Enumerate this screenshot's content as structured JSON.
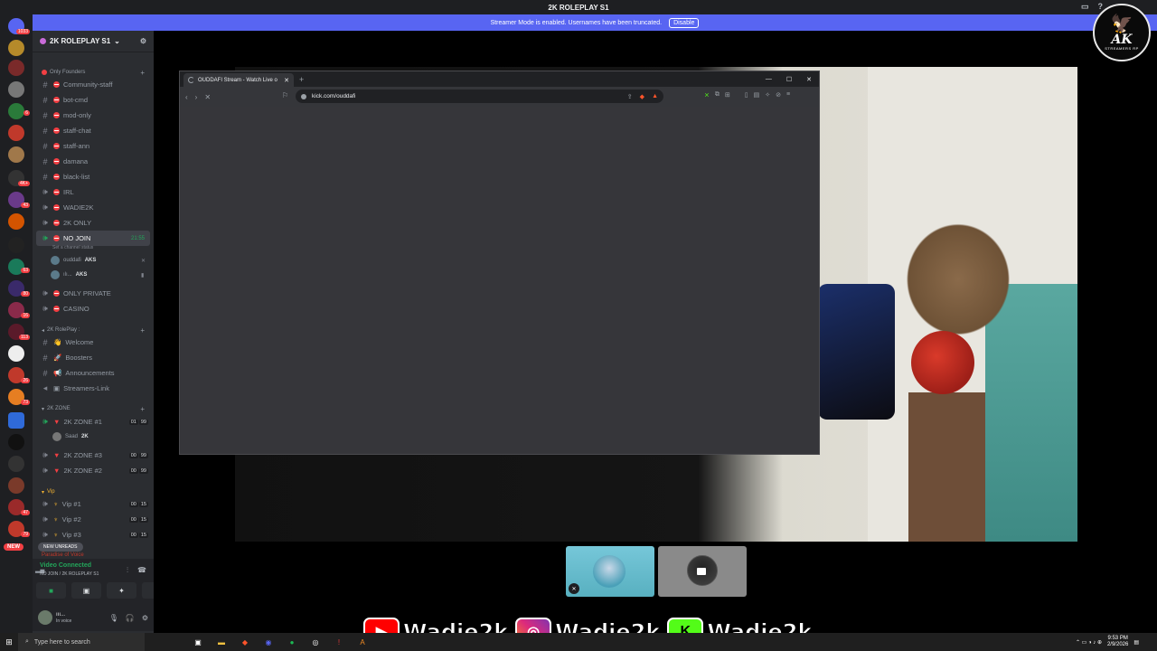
{
  "discord": {
    "window_title": "2K ROLEPLAY S1",
    "notice": {
      "text": "Streamer Mode is enabled. Usernames have been truncated.",
      "button": "Disable"
    },
    "server_name": "2K ROLEPLAY S1",
    "rail_badges": [
      "1033",
      "6",
      "4K+",
      "43",
      "63",
      "80",
      "16",
      "113",
      "26",
      "73",
      "66",
      "47",
      "79"
    ],
    "rail_new": "NEW",
    "categories": {
      "founders": "Only Founders",
      "roleplay": "2K RolePlay :",
      "zone": "2K ZONE",
      "vip": "Vip",
      "paradise": "Paradise of Voice"
    },
    "channels": [
      {
        "name": "Community-staff",
        "type": "text",
        "restricted": true
      },
      {
        "name": "bot-cmd",
        "type": "text",
        "restricted": true
      },
      {
        "name": "mod-only",
        "type": "text",
        "restricted": true
      },
      {
        "name": "staff-chat",
        "type": "text",
        "restricted": true
      },
      {
        "name": "staff-ann",
        "type": "text",
        "restricted": true
      },
      {
        "name": "damana",
        "type": "text",
        "restricted": true
      },
      {
        "name": "black-list",
        "type": "text",
        "restricted": true
      },
      {
        "name": "IRL",
        "type": "voice",
        "restricted": true
      },
      {
        "name": "WADIE2K",
        "type": "voice",
        "restricted": true
      },
      {
        "name": "2K ONLY",
        "type": "voice",
        "restricted": true
      },
      {
        "name": "NO JOIN",
        "type": "voice",
        "restricted": true,
        "time": "21:55",
        "active": true
      },
      {
        "name": "ONLY PRIVATE",
        "type": "voice",
        "restricted": true
      },
      {
        "name": "CASINO",
        "type": "voice",
        "restricted": true
      }
    ],
    "status_hint": "Set a channel status",
    "voice_members": [
      {
        "name": "ouddafi",
        "tag": "AKS"
      },
      {
        "name": "ılı...",
        "tag": "AKS"
      }
    ],
    "roleplay_channels": [
      {
        "name": "Welcome",
        "icon": "wave"
      },
      {
        "name": "Boosters",
        "icon": "rocket"
      },
      {
        "name": "Announcements",
        "icon": "megaphone"
      },
      {
        "name": "Streamers-Link",
        "icon": "video"
      }
    ],
    "zone_channels": [
      {
        "name": "2K ZONE #1",
        "left": "01",
        "right": "99"
      },
      {
        "name": "2K ZONE #3",
        "left": "00",
        "right": "99"
      },
      {
        "name": "2K ZONE #2",
        "left": "00",
        "right": "99"
      }
    ],
    "zone_member": {
      "name": "Saad",
      "tag": "2K"
    },
    "vip_channels": [
      {
        "name": "Vip #1",
        "left": "00",
        "right": "15"
      },
      {
        "name": "Vip #2",
        "left": "00",
        "right": "15"
      },
      {
        "name": "Vip #3",
        "left": "00",
        "right": "15"
      }
    ],
    "new_unreads": "NEW UNREADS",
    "voice_panel": {
      "title": "Video Connected",
      "subtitle": "NO JOIN / 2K ROLEPLAY S1"
    },
    "user": {
      "name": "ııı...",
      "status": "In voice"
    }
  },
  "browser": {
    "tab_title": "OUDDAFI Stream - Watch Live o",
    "url": "kick.com/ouddafi"
  },
  "overlay": {
    "logo_text": "AK",
    "logo_sub": "STREAMERS RP",
    "social_handle": "Wadie2k",
    "socials": [
      {
        "platform": "YouTube",
        "icon": "youtube-icon",
        "handle": "Wadie2k"
      },
      {
        "platform": "Instagram",
        "icon": "instagram-icon",
        "handle": "Wadie2k"
      },
      {
        "platform": "Kick",
        "icon": "kick-icon",
        "handle": "Wadie2k"
      }
    ]
  },
  "taskbar": {
    "search_placeholder": "Type here to search",
    "time": "9:53 PM",
    "date": "2/9/2026"
  }
}
